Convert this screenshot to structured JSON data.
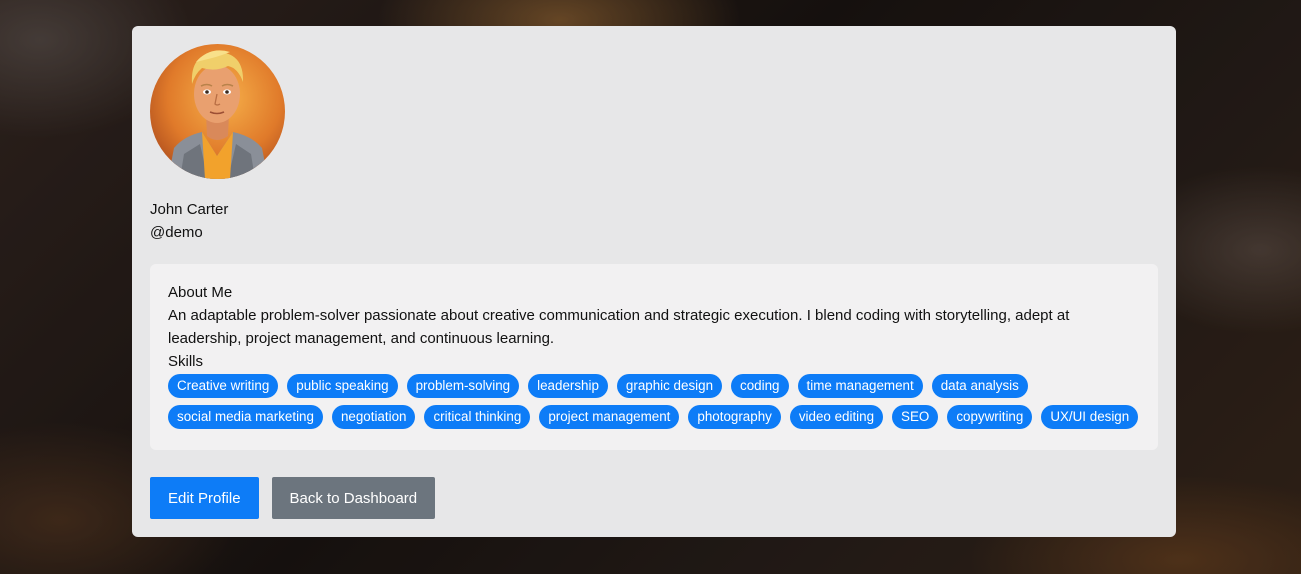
{
  "profile": {
    "full_name": "John Carter",
    "username": "@demo"
  },
  "about": {
    "heading": "About Me",
    "text": "An adaptable problem-solver passionate about creative communication and strategic execution. I blend coding with storytelling, adept at leadership, project management, and continuous learning."
  },
  "skills": {
    "heading": "Skills",
    "items": [
      "Creative writing",
      "public speaking",
      "problem-solving",
      "leadership",
      "graphic design",
      "coding",
      "time management",
      "data analysis",
      "social media marketing",
      "negotiation",
      "critical thinking",
      "project management",
      "photography",
      "video editing",
      "SEO",
      "copywriting",
      "UX/UI design"
    ]
  },
  "actions": {
    "edit_label": "Edit Profile",
    "back_label": "Back to Dashboard"
  },
  "colors": {
    "primary": "#0d7cf7",
    "secondary": "#6c757e",
    "card": "#e7e7e8",
    "panel": "#f2f1f2"
  }
}
